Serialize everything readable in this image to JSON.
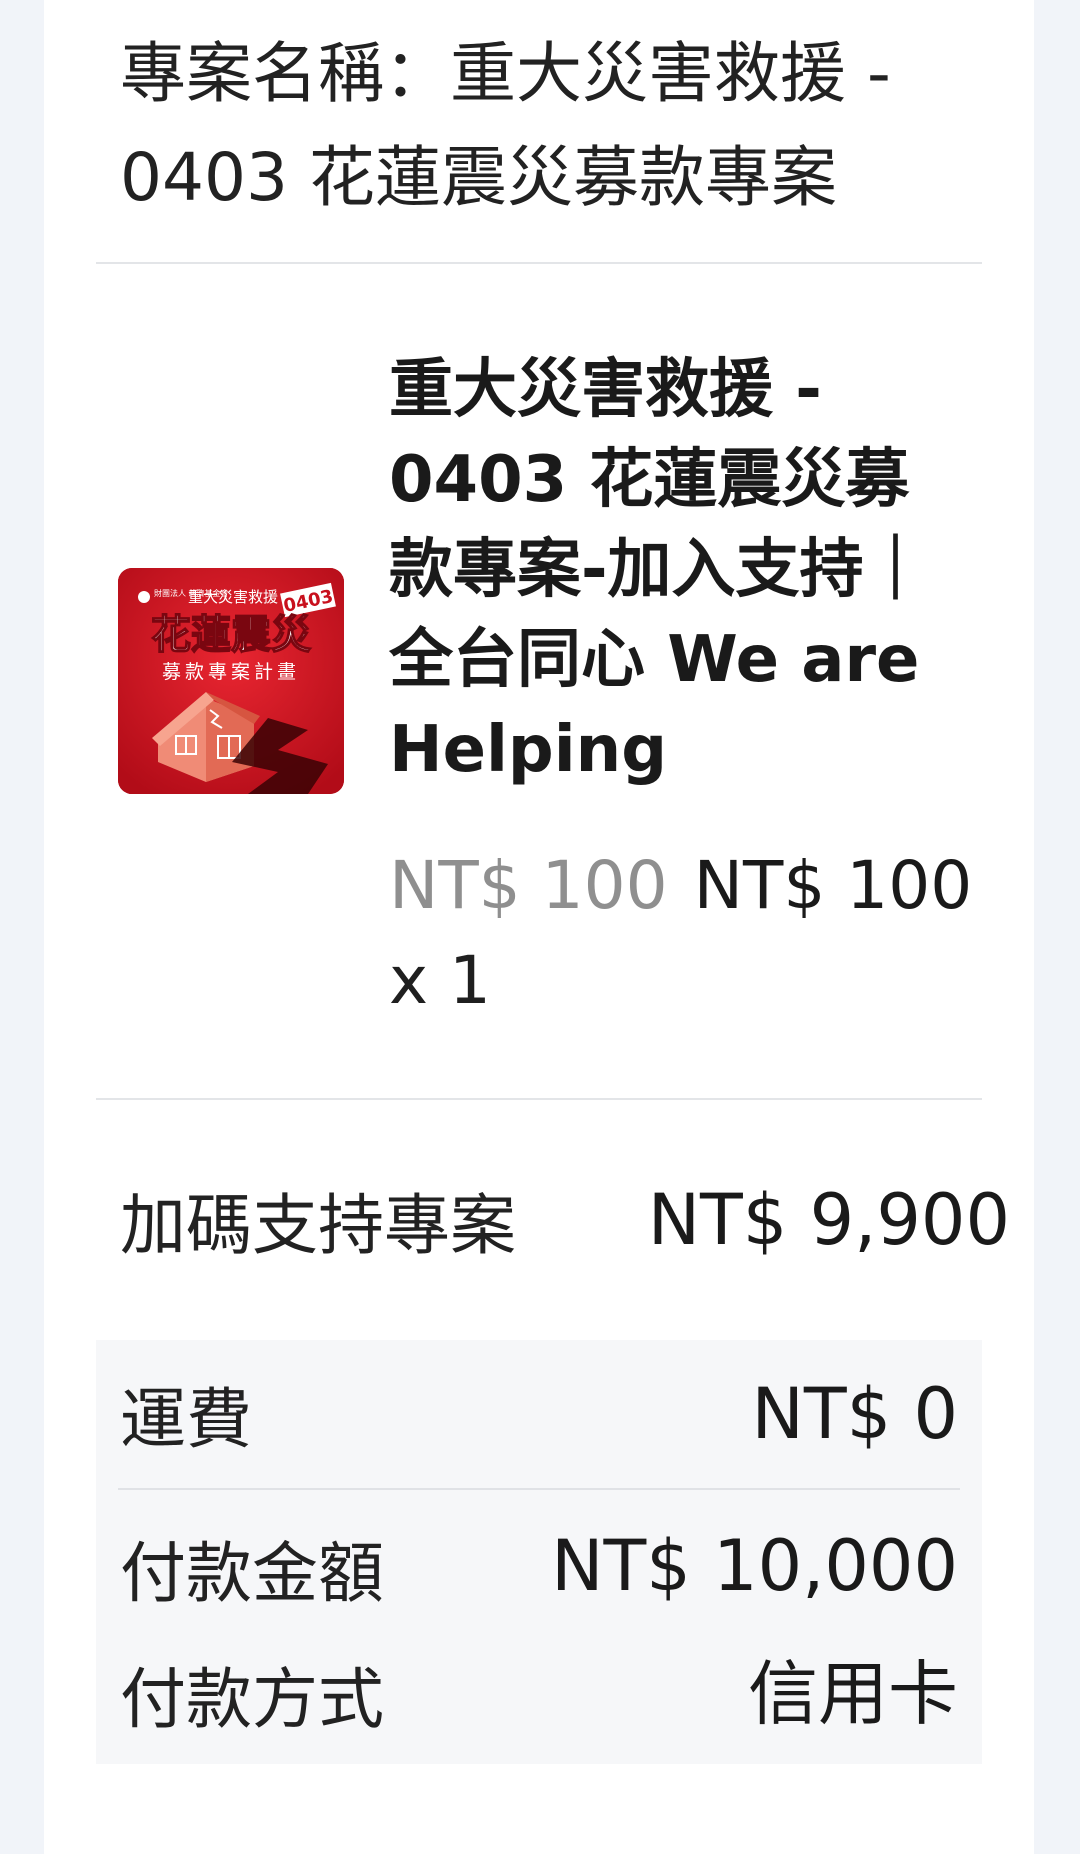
{
  "project": {
    "name": "專案名稱：重大災害救援 - 0403 花蓮震災募款專案"
  },
  "product": {
    "image_icon": "donation-campaign-image",
    "image_texts": {
      "org": "財團法人 慈濟基金會",
      "topic": "重大災害救援",
      "code": "0403",
      "main": "花蓮震災",
      "sub": "募款專案計畫"
    },
    "title": "重大災害救援 - 0403 花蓮震災募款專案-加入支持｜全台同心 We are Helping",
    "original_price": "NT$ 100",
    "price": "NT$ 100",
    "quantity": "x 1"
  },
  "extra_support": {
    "label": "加碼支持專案",
    "value": "NT$ 9,900"
  },
  "summary": {
    "shipping_label": "運費",
    "shipping_value": "NT$ 0",
    "total_label": "付款金額",
    "total_value": "NT$ 10,000",
    "method_label": "付款方式",
    "method_value": "信用卡"
  },
  "colors": {
    "page_bg": "#f1f4f9",
    "brand_red": "#d0121f",
    "muted_price": "#8f8f8f"
  }
}
